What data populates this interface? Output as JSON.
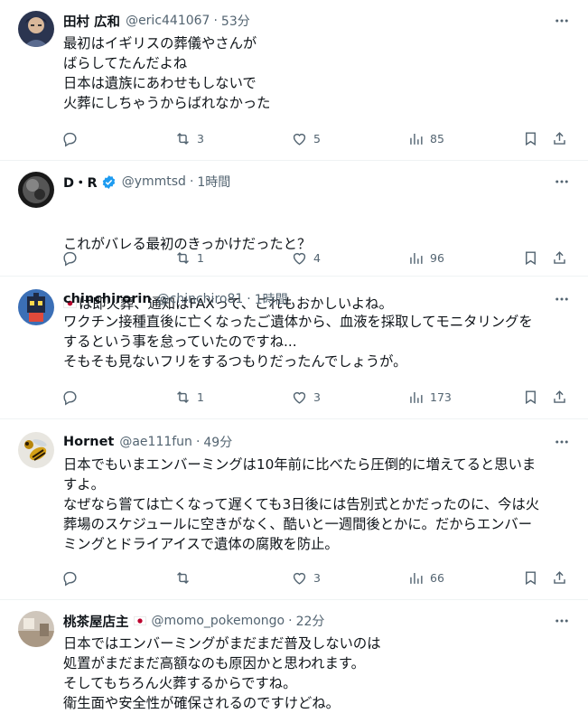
{
  "tweets": [
    {
      "name": "田村 広和",
      "handle": "@eric441067",
      "time": "53分",
      "text": "最初はイギリスの葬儀やさんが\nばらしてたんだよね\n日本は遺族にあわせもしないで\n火葬にしちゃうからばれなかった",
      "reply_count": "",
      "retweet_count": "3",
      "like_count": "5",
      "view_count": "85",
      "verified": false,
      "avatar_icon": "anime-character-avatar"
    },
    {
      "name": "D・R",
      "handle": "@ymmtsd",
      "time": "1時間",
      "text_line1": "これがバレる最初のきっかけだったと？",
      "text_line2": "は即火葬、通知はFAXって、これもおかしいよね。",
      "reply_count": "",
      "retweet_count": "1",
      "like_count": "4",
      "view_count": "96",
      "verified": true,
      "verified_color": "#1d9bf0",
      "avatar_icon": "dark-sphere-avatar"
    },
    {
      "name": "chinchirorin",
      "handle": "@chinchiro81",
      "time": "1時間",
      "text": "ワクチン接種直後に亡くなったご遺体から、血液を採取してモニタリングを\nするという事を怠っていたのですね...\nそもそも見ないフリをするつもりだったんでしょうが。",
      "reply_count": "",
      "retweet_count": "1",
      "like_count": "3",
      "view_count": "173",
      "verified": false,
      "avatar_icon": "pixel-robot-avatar"
    },
    {
      "name": "Hornet",
      "handle": "@ae111fun",
      "time": "49分",
      "text": "日本でもいまエンバーミングは10年前に比べたら圧倒的に増えてると思いま\nすよ。\nなぜなら嘗ては亡くなって遅くても3日後には告別式とかだったのに、今は火\n葬場のスケジュールに空きがなく、酷いと一週間後とかに。だからエンバー\nミングとドライアイスで遺体の腐敗を防止。",
      "reply_count": "",
      "retweet_count": "",
      "like_count": "3",
      "view_count": "66",
      "verified": false,
      "avatar_icon": "hornet-avatar"
    },
    {
      "name": "桃茶屋店主",
      "handle": "@momo_pokemongo",
      "time": "22分",
      "text": "日本ではエンバーミングがまだまだ普及しないのは\n処置がまだまだ高額なのも原因かと思われます。\nそしてもちろん火葬するからですね。\n衛生面や安全性が確保されるのですけどね。",
      "verified": false,
      "avatar_icon": "room-photo-avatar"
    }
  ],
  "colors": {
    "text": "#0f1419",
    "secondary": "#536471",
    "divider": "#eff3f4",
    "verified": "#1d9bf0",
    "flag_red": "#bc002d"
  }
}
